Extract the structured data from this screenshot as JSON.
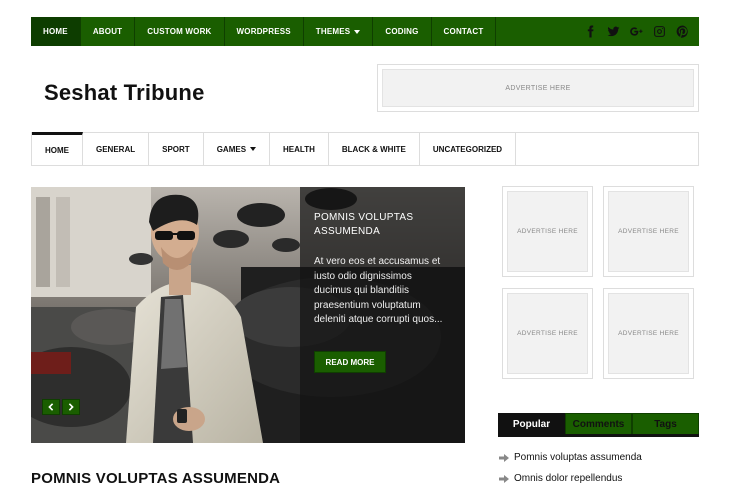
{
  "topnav": {
    "items": [
      {
        "label": "HOME",
        "active": true
      },
      {
        "label": "ABOUT"
      },
      {
        "label": "CUSTOM WORK"
      },
      {
        "label": "WORDPRESS"
      },
      {
        "label": "THEMES",
        "dropdown": true
      },
      {
        "label": "CODING"
      },
      {
        "label": "CONTACT"
      }
    ],
    "social_icons": [
      "facebook-icon",
      "twitter-icon",
      "google-plus-icon",
      "instagram-icon",
      "pinterest-icon"
    ]
  },
  "header": {
    "site_title": "Seshat Tribune",
    "ad_label": "ADVERTISE HERE"
  },
  "mainnav": {
    "items": [
      {
        "label": "HOME",
        "active": true
      },
      {
        "label": "GENERAL"
      },
      {
        "label": "SPORT"
      },
      {
        "label": "GAMES",
        "dropdown": true
      },
      {
        "label": "HEALTH"
      },
      {
        "label": "BLACK & WHITE"
      },
      {
        "label": "UNCATEGORIZED"
      }
    ]
  },
  "slider": {
    "title": "POMNIS VOLUPTAS ASSUMENDA",
    "excerpt": "At vero eos et accusamus et iusto odio dignissimos ducimus qui blanditiis praesentium voluptatum deleniti atque corrupti quos...",
    "read_more": "READ MORE"
  },
  "post": {
    "title": "POMNIS VOLUPTAS ASSUMENDA"
  },
  "sidebar": {
    "ads": [
      "ADVERTISE HERE",
      "ADVERTISE HERE",
      "ADVERTISE HERE",
      "ADVERTISE HERE"
    ],
    "tabs": [
      {
        "label": "Popular",
        "active": true
      },
      {
        "label": "Comments"
      },
      {
        "label": "Tags"
      }
    ],
    "popular": [
      "Pomnis voluptas assumenda",
      "Omnis dolor repellendus"
    ]
  },
  "colors": {
    "accent": "#1a5e00",
    "dark": "#111111"
  }
}
